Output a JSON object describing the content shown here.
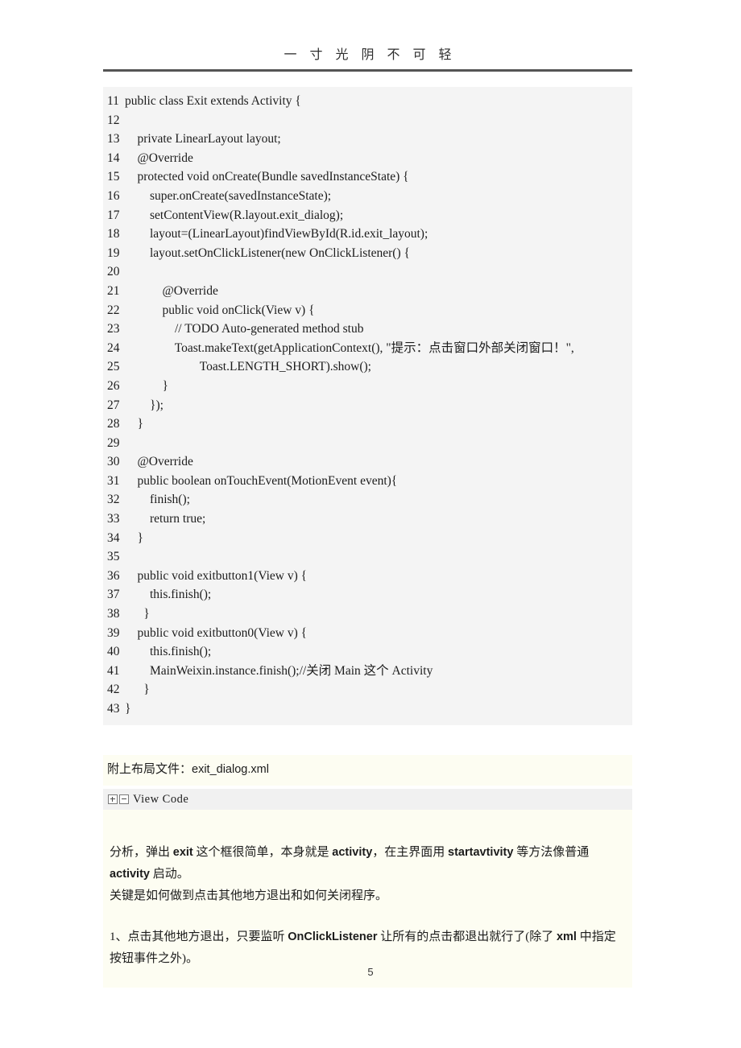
{
  "header": {
    "title": "一 寸 光 阴 不 可 轻"
  },
  "code_block": {
    "language": "java",
    "lines": [
      {
        "num": "11",
        "text": "public class Exit extends Activity {"
      },
      {
        "num": "12",
        "text": ""
      },
      {
        "num": "13",
        "text": "    private LinearLayout layout;"
      },
      {
        "num": "14",
        "text": "    @Override"
      },
      {
        "num": "15",
        "text": "    protected void onCreate(Bundle savedInstanceState) {"
      },
      {
        "num": "16",
        "text": "        super.onCreate(savedInstanceState);"
      },
      {
        "num": "17",
        "text": "        setContentView(R.layout.exit_dialog);"
      },
      {
        "num": "18",
        "text": "        layout=(LinearLayout)findViewById(R.id.exit_layout);"
      },
      {
        "num": "19",
        "text": "        layout.setOnClickListener(new OnClickListener() {"
      },
      {
        "num": "20",
        "text": ""
      },
      {
        "num": "21",
        "text": "            @Override"
      },
      {
        "num": "22",
        "text": "            public void onClick(View v) {"
      },
      {
        "num": "23",
        "text": "                // TODO Auto-generated method stub"
      },
      {
        "num": "24",
        "text": "                Toast.makeText(getApplicationContext(), \"提示：点击窗口外部关闭窗口！\","
      },
      {
        "num": "25",
        "text": "                        Toast.LENGTH_SHORT).show();"
      },
      {
        "num": "26",
        "text": "            }"
      },
      {
        "num": "27",
        "text": "        });"
      },
      {
        "num": "28",
        "text": "    }"
      },
      {
        "num": "29",
        "text": ""
      },
      {
        "num": "30",
        "text": "    @Override"
      },
      {
        "num": "31",
        "text": "    public boolean onTouchEvent(MotionEvent event){"
      },
      {
        "num": "32",
        "text": "        finish();"
      },
      {
        "num": "33",
        "text": "        return true;"
      },
      {
        "num": "34",
        "text": "    }"
      },
      {
        "num": "35",
        "text": ""
      },
      {
        "num": "36",
        "text": "    public void exitbutton1(View v) {"
      },
      {
        "num": "37",
        "text": "        this.finish();"
      },
      {
        "num": "38",
        "text": "      }"
      },
      {
        "num": "39",
        "text": "    public void exitbutton0(View v) {"
      },
      {
        "num": "40",
        "text": "        this.finish();"
      },
      {
        "num": "41",
        "text": "        MainWeixin.instance.finish();//关闭 Main 这个 Activity"
      },
      {
        "num": "42",
        "text": "      }"
      },
      {
        "num": "43",
        "text": "}"
      }
    ]
  },
  "attachment": {
    "label": "附上布局文件：",
    "filename": "exit_dialog.xml"
  },
  "view_code": {
    "expand_icon": "plus-box-icon",
    "collapse_icon": "minus-box-icon",
    "label": "View Code"
  },
  "prose": {
    "paragraph_1_part_1": "分析，弹出 ",
    "paragraph_1_en_1": "exit",
    "paragraph_1_part_2": " 这个框很简单，本身就是 ",
    "paragraph_1_en_2": "activity",
    "paragraph_1_part_3": "，在主界面用 ",
    "paragraph_1_en_3": "startavtivity",
    "paragraph_1_part_4": " 等方法像普通 ",
    "paragraph_1_en_4": "activity",
    "paragraph_1_part_5": " 启动。",
    "paragraph_2": "关键是如何做到点击其他地方退出和如何关闭程序。",
    "paragraph_3_part_1": "1、点击其他地方退出，只要监听 ",
    "paragraph_3_en_1": "OnClickListener",
    "paragraph_3_part_2": " 让所有的点击都退出就行了(除了 ",
    "paragraph_3_en_2": "xml",
    "paragraph_3_part_3": " 中指定按钮事件之外)。"
  },
  "footer": {
    "page_number": "5"
  },
  "colors": {
    "code_background": "#f4f4f4",
    "prose_background": "#fdfdf2",
    "viewcode_background": "#f1f1f1",
    "rule": "#555555",
    "text": "#1c1c1c"
  }
}
